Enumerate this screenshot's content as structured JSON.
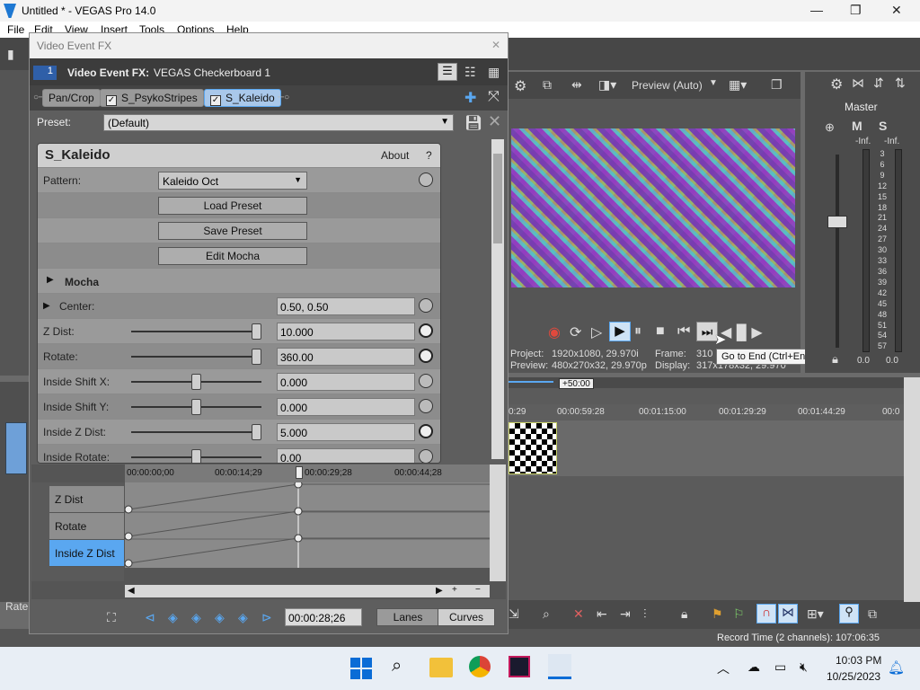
{
  "app": {
    "title": "Untitled * - VEGAS Pro 14.0"
  },
  "window_controls": {
    "minimize": "—",
    "restore": "❐",
    "close": "✕"
  },
  "menu": [
    "File",
    "Edit",
    "View",
    "Insert",
    "Tools",
    "Options",
    "Help"
  ],
  "preview": {
    "quality": "Preview (Auto)",
    "project_label": "Project:",
    "project_value": "1920x1080, 29.970i",
    "preview_label": "Preview:",
    "preview_value": "480x270x32, 29.970p",
    "frame_label": "Frame:",
    "frame_value": "310",
    "display_label": "Display:",
    "display_value": "317x178x32, 29.970",
    "tooltip": "Go to End (Ctrl+End)"
  },
  "mixer": {
    "master_label": "Master",
    "meter_left": "-Inf.",
    "meter_right": "-Inf.",
    "scale": [
      "3",
      "6",
      "9",
      "12",
      "15",
      "18",
      "21",
      "24",
      "27",
      "30",
      "33",
      "36",
      "39",
      "42",
      "45",
      "48",
      "51",
      "54",
      "57"
    ],
    "bottom_left": "0.0",
    "bottom_right": "0.0"
  },
  "timeline": {
    "marker": "+50:00",
    "ruler": [
      "0:29",
      "00:00:59:28",
      "00:01:15:00",
      "00:01:29:29",
      "00:01:44:29",
      "00:0"
    ]
  },
  "status": {
    "rate_label": "Rate:",
    "record_time": "Record Time (2 channels): 107:06:35"
  },
  "fx": {
    "window_title": "Video Event FX",
    "close": "✕",
    "badge": "1",
    "header_label": "Video Event FX:",
    "header_value": "VEGAS Checkerboard 1",
    "chain": [
      "Pan/Crop",
      "S_PsykoStripes",
      "S_Kaleido"
    ],
    "preset_label": "Preset:",
    "preset_value": "(Default)",
    "plugin_name": "S_Kaleido",
    "about": "About",
    "help": "?",
    "pattern_label": "Pattern:",
    "pattern_value": "Kaleido Oct",
    "load_preset": "Load Preset",
    "save_preset": "Save Preset",
    "edit_mocha": "Edit Mocha",
    "mocha_group": "Mocha",
    "center_label": "Center:",
    "center_value": "0.50, 0.50",
    "params": [
      {
        "label": "Z Dist:",
        "value": "10.000",
        "slider": 1.0
      },
      {
        "label": "Rotate:",
        "value": "360.00",
        "slider": 1.0
      },
      {
        "label": "Inside Shift X:",
        "value": "0.000",
        "slider": 0.5
      },
      {
        "label": "Inside Shift Y:",
        "value": "0.000",
        "slider": 0.5
      },
      {
        "label": "Inside Z Dist:",
        "value": "5.000",
        "slider": 1.0
      },
      {
        "label": "Inside Rotate:",
        "value": "0.00",
        "slider": 0.5
      }
    ],
    "keyframes": {
      "ruler": [
        "00:00:00;00",
        "00:00:14;29",
        "00:00:29;28",
        "00:00:44;28"
      ],
      "tracks": [
        "Z Dist",
        "Rotate",
        "Inside Z Dist"
      ]
    },
    "timecode": "00:00:28;26",
    "lanes": "Lanes",
    "curves": "Curves"
  },
  "taskbar": {
    "time": "10:03 PM",
    "date": "10/25/2023"
  }
}
